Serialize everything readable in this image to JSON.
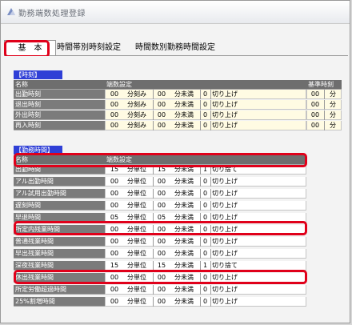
{
  "window": {
    "title": "勤務端数処理登録"
  },
  "tabs": [
    {
      "label": "基　本",
      "active": true
    },
    {
      "label": "時間帯別時刻設定",
      "active": false
    },
    {
      "label": "時間数別勤務時間設定",
      "active": false
    }
  ],
  "section1": {
    "title": "【時刻】",
    "col_name": "名称",
    "col_setting": "端数設定",
    "col_base": "基準時刻",
    "rows": [
      {
        "name": "出勤時刻",
        "unit_val": "00",
        "unit_label": "分刻み",
        "under_val": "00",
        "under_label": "分未満",
        "flag": "0",
        "mode": "切り上げ",
        "base_val": "00",
        "base_unit": "分"
      },
      {
        "name": "退出時刻",
        "unit_val": "00",
        "unit_label": "分刻み",
        "under_val": "00",
        "under_label": "分未満",
        "flag": "0",
        "mode": "切り上げ",
        "base_val": "00",
        "base_unit": "分"
      },
      {
        "name": "外出時刻",
        "unit_val": "00",
        "unit_label": "分刻み",
        "under_val": "00",
        "under_label": "分未満",
        "flag": "0",
        "mode": "切り上げ",
        "base_val": "00",
        "base_unit": "分"
      },
      {
        "name": "再入時刻",
        "unit_val": "00",
        "unit_label": "分刻み",
        "under_val": "00",
        "under_label": "分未満",
        "flag": "0",
        "mode": "切り上げ",
        "base_val": "00",
        "base_unit": "分"
      }
    ]
  },
  "section2": {
    "title": "【勤務時間】",
    "col_name": "名称",
    "col_setting": "端数設定",
    "rows": [
      {
        "name": "出勤時間",
        "unit_val": "15",
        "unit_label": "分単位",
        "under_val": "15",
        "under_label": "分未満",
        "flag": "1",
        "mode": "切り捨て",
        "highlight": true
      },
      {
        "name": "アル出勤時間",
        "unit_val": "00",
        "unit_label": "分単位",
        "under_val": "00",
        "under_label": "分未満",
        "flag": "0",
        "mode": "切り上げ",
        "highlight": false
      },
      {
        "name": "アル試用出勤時間",
        "unit_val": "00",
        "unit_label": "分単位",
        "under_val": "00",
        "under_label": "分未満",
        "flag": "0",
        "mode": "切り上げ",
        "highlight": false
      },
      {
        "name": "遅刻時間",
        "unit_val": "00",
        "unit_label": "分単位",
        "under_val": "00",
        "under_label": "分未満",
        "flag": "0",
        "mode": "切り上げ",
        "highlight": false
      },
      {
        "name": "早退時間",
        "unit_val": "05",
        "unit_label": "分単位",
        "under_val": "05",
        "under_label": "分未満",
        "flag": "0",
        "mode": "切り上げ",
        "highlight": true
      },
      {
        "name": "所定内残業時間",
        "unit_val": "00",
        "unit_label": "分単位",
        "under_val": "00",
        "under_label": "分未満",
        "flag": "0",
        "mode": "切り上げ",
        "highlight": false
      },
      {
        "name": "普通残業時間",
        "unit_val": "00",
        "unit_label": "分単位",
        "under_val": "00",
        "under_label": "分未満",
        "flag": "0",
        "mode": "切り上げ",
        "highlight": false
      },
      {
        "name": "早出残業時間",
        "unit_val": "00",
        "unit_label": "分単位",
        "under_val": "00",
        "under_label": "分未満",
        "flag": "0",
        "mode": "切り上げ",
        "highlight": false
      },
      {
        "name": "深夜残業時間",
        "unit_val": "15",
        "unit_label": "分単位",
        "under_val": "15",
        "under_label": "分未満",
        "flag": "1",
        "mode": "切り捨て",
        "highlight": true
      },
      {
        "name": "休出残業時間",
        "unit_val": "00",
        "unit_label": "分単位",
        "under_val": "00",
        "under_label": "分未満",
        "flag": "0",
        "mode": "切り上げ",
        "highlight": false
      },
      {
        "name": "所定労働超過時間",
        "unit_val": "00",
        "unit_label": "分単位",
        "under_val": "00",
        "under_label": "分未満",
        "flag": "0",
        "mode": "切り上げ",
        "highlight": false
      },
      {
        "name": "25%割増時間",
        "unit_val": "00",
        "unit_label": "分単位",
        "under_val": "00",
        "under_label": "分未満",
        "flag": "0",
        "mode": "切り上げ",
        "highlight": false
      }
    ]
  },
  "colors": {
    "accent_red": "#e0001a",
    "section_header": "#2f3fd6",
    "label_bg": "#7b7b7b"
  }
}
